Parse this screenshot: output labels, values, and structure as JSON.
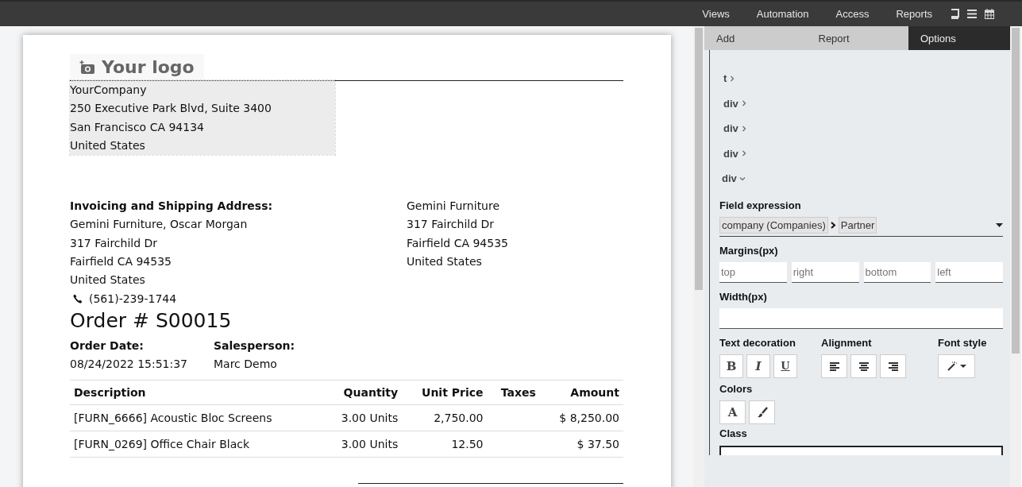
{
  "top_menu": {
    "items": [
      "Views",
      "Automation",
      "Access",
      "Reports"
    ]
  },
  "report": {
    "logo": "Your logo",
    "company_lines": [
      "YourCompany",
      "250 Executive Park Blvd, Suite 3400",
      "San Francisco CA 94134",
      "United States"
    ],
    "address_title": "Invoicing and Shipping Address:",
    "address_lines": [
      "Gemini Furniture, Oscar Morgan",
      "317 Fairchild Dr",
      "Fairfield CA 94535",
      "United States"
    ],
    "phone": "(561)-239-1744",
    "partner_lines": [
      "Gemini Furniture",
      "317 Fairchild Dr",
      "Fairfield CA 94535",
      "United States"
    ],
    "title": "Order # S00015",
    "info": [
      {
        "label": "Order Date:",
        "value": "08/24/2022 15:51:37"
      },
      {
        "label": "Salesperson:",
        "value": "Marc Demo"
      }
    ],
    "table": {
      "columns": [
        "Description",
        "Quantity",
        "Unit Price",
        "Taxes",
        "Amount"
      ],
      "rows": [
        [
          "[FURN_6666] Acoustic Bloc Screens",
          "3.00 Units",
          "2,750.00",
          "",
          "$ 8,250.00"
        ],
        [
          "[FURN_0269] Office Chair Black",
          "3.00 Units",
          "12.50",
          "",
          "$ 37.50"
        ]
      ]
    }
  },
  "sidebar": {
    "tabs": [
      {
        "label": "Add",
        "selected": false
      },
      {
        "label": "Report",
        "selected": false
      },
      {
        "label": "Options",
        "selected": true
      }
    ],
    "tree": [
      {
        "label": "t",
        "expanded": false
      },
      {
        "label": "div",
        "expanded": false
      },
      {
        "label": "div",
        "expanded": false
      },
      {
        "label": "div",
        "expanded": false
      },
      {
        "label": "div",
        "expanded": true
      }
    ],
    "field_expression": {
      "label": "Field expression",
      "chips": [
        "company (Companies)",
        "Partner"
      ]
    },
    "margins": {
      "label": "Margins(px)",
      "placeholders": [
        "top",
        "right",
        "bottom",
        "left"
      ]
    },
    "width": {
      "label": "Width(px)"
    },
    "text_decoration": {
      "label": "Text decoration",
      "buttons": [
        "B",
        "I",
        "U"
      ]
    },
    "alignment": {
      "label": "Alignment"
    },
    "font_style": {
      "label": "Font style"
    },
    "colors": {
      "label": "Colors",
      "text_button": "A"
    },
    "class": {
      "label": "Class"
    }
  }
}
